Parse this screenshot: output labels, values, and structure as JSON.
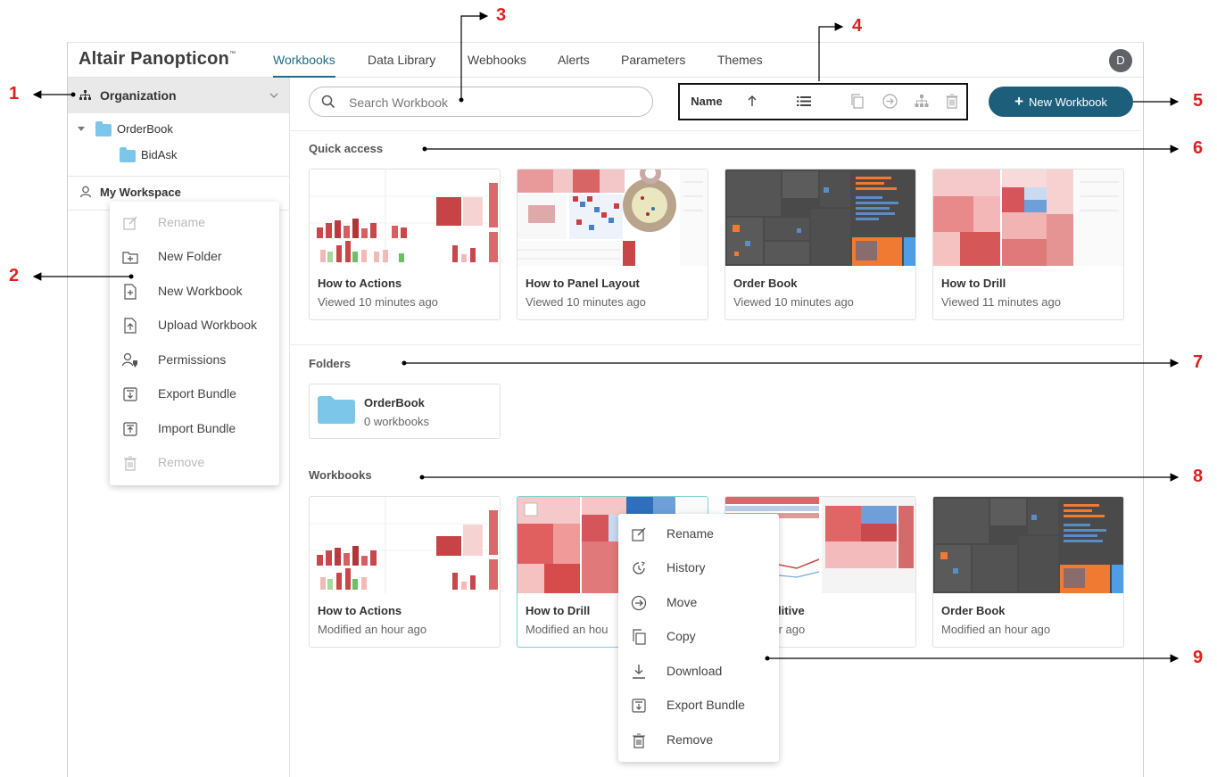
{
  "app": {
    "brand": "Altair Panopticon",
    "brand_tm": "™",
    "tabs": [
      {
        "label": "Workbooks"
      },
      {
        "label": "Data Library"
      },
      {
        "label": "Webhooks"
      },
      {
        "label": "Alerts"
      },
      {
        "label": "Parameters"
      },
      {
        "label": "Themes"
      }
    ],
    "avatar_initial": "D"
  },
  "sidebar": {
    "organization_label": "Organization",
    "tree": [
      {
        "label": "OrderBook"
      },
      {
        "label": "BidAsk"
      }
    ],
    "my_workspace_label": "My Workspace"
  },
  "workspace_menu": [
    {
      "label": "Rename",
      "icon": "rename-icon",
      "disabled": true
    },
    {
      "label": "New Folder",
      "icon": "new-folder-icon"
    },
    {
      "label": "New Workbook",
      "icon": "new-workbook-icon"
    },
    {
      "label": "Upload Workbook",
      "icon": "upload-icon"
    },
    {
      "label": "Permissions",
      "icon": "permissions-icon"
    },
    {
      "label": "Export Bundle",
      "icon": "export-bundle-icon"
    },
    {
      "label": "Import Bundle",
      "icon": "import-bundle-icon"
    },
    {
      "label": "Remove",
      "icon": "trash-icon",
      "disabled": true
    }
  ],
  "search": {
    "placeholder": "Search Workbook"
  },
  "toolbar": {
    "sort_label": "Name"
  },
  "new_workbook_button": "New Workbook",
  "quick_access": {
    "title": "Quick access",
    "cards": [
      {
        "title": "How to Actions",
        "subtitle": "Viewed 10 minutes ago"
      },
      {
        "title": "How to Panel Layout",
        "subtitle": "Viewed 10 minutes ago"
      },
      {
        "title": "Order Book",
        "subtitle": "Viewed 10 minutes ago"
      },
      {
        "title": "How to Drill",
        "subtitle": "Viewed 11 minutes ago"
      }
    ]
  },
  "folders": {
    "title": "Folders",
    "items": [
      {
        "name": "OrderBook",
        "count": "0 workbooks"
      }
    ]
  },
  "workbooks": {
    "title": "Workbooks",
    "cards": [
      {
        "title": "How to Actions",
        "subtitle": "Modified an hour ago"
      },
      {
        "title": "How to Drill",
        "subtitle": "Modified an hou"
      },
      {
        "title": "Non Additive",
        "subtitle": "d an hour ago"
      },
      {
        "title": "Order Book",
        "subtitle": "Modified an hour ago"
      }
    ]
  },
  "workbook_menu": [
    {
      "label": "Rename",
      "icon": "rename-icon"
    },
    {
      "label": "History",
      "icon": "history-icon"
    },
    {
      "label": "Move",
      "icon": "move-icon"
    },
    {
      "label": "Copy",
      "icon": "copy-icon"
    },
    {
      "label": "Download",
      "icon": "download-icon"
    },
    {
      "label": "Export Bundle",
      "icon": "export-bundle-icon"
    },
    {
      "label": "Remove",
      "icon": "trash-icon"
    }
  ],
  "annotations": [
    "1",
    "2",
    "3",
    "4",
    "5",
    "6",
    "7",
    "8",
    "9"
  ],
  "colors": {
    "accent": "#1f6d8a",
    "primary_button": "#1d5f7b",
    "annotation": "#e0201d",
    "folder": "#7cc6ea"
  }
}
